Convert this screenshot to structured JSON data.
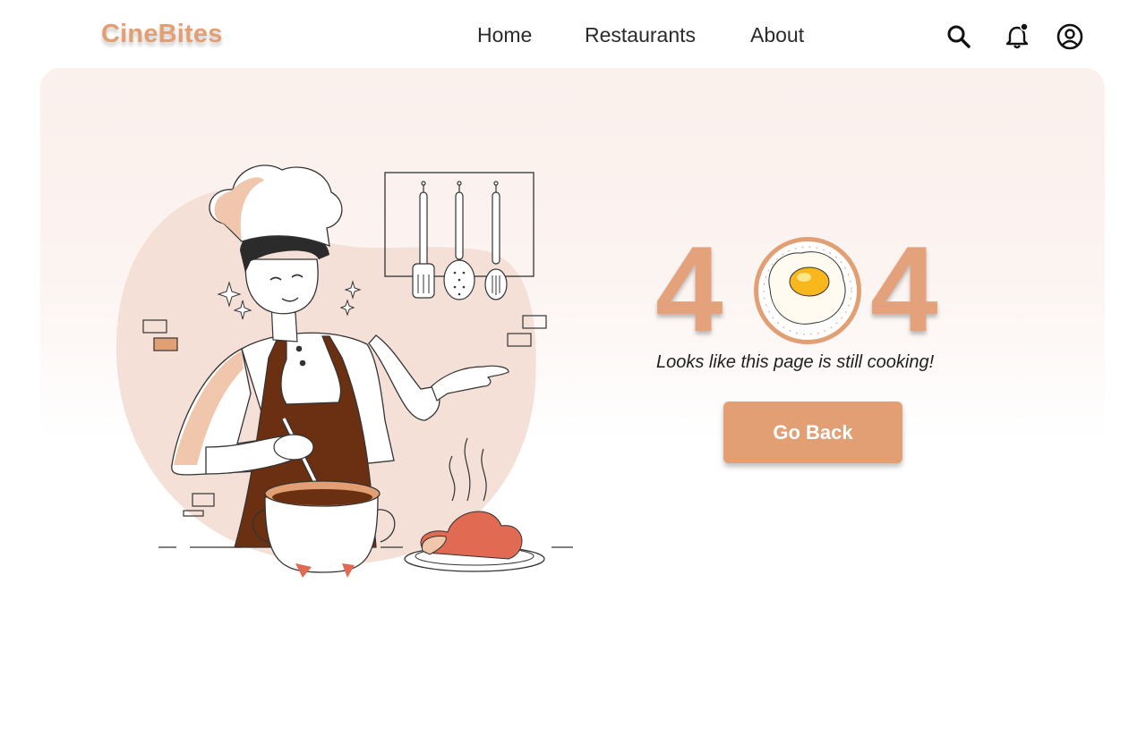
{
  "app": {
    "logo": "CineBites"
  },
  "nav": {
    "items": [
      {
        "label": "Home"
      },
      {
        "label": "Restaurants"
      },
      {
        "label": "About"
      }
    ]
  },
  "header_icons": [
    "search-icon",
    "notification-bell-icon",
    "account-circle-icon"
  ],
  "error": {
    "digit_left": "4",
    "digit_right": "4",
    "message": "Looks like this page is still cooking!",
    "button_label": "Go Back"
  },
  "colors": {
    "accent": "#e39f74",
    "hero_background": "#faf0ec",
    "apron": "#6b2f12",
    "sauce": "#e06a52"
  }
}
